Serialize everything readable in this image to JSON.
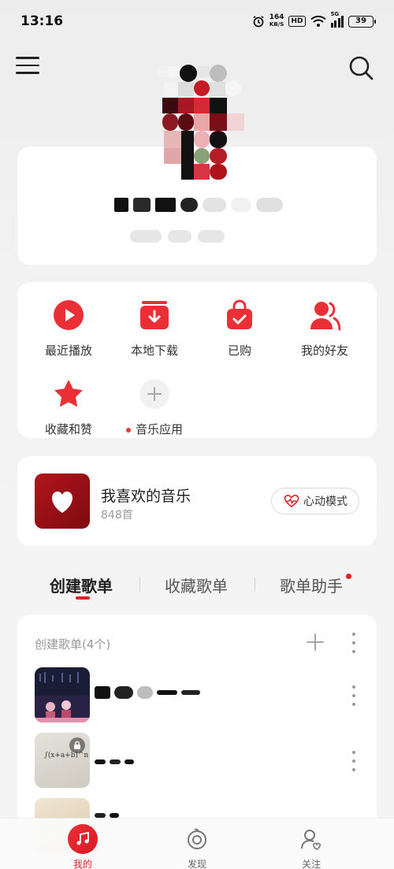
{
  "status_bar": {
    "time": "13:16",
    "network_speed_value": "164",
    "network_speed_unit": "KB/S",
    "hd_label": "HD",
    "signal_label": "5G",
    "battery": "39"
  },
  "colors": {
    "accent": "#e5202b",
    "background": "#f3f3f3",
    "card": "#ffffff",
    "liked_cover": "#9e0f16"
  },
  "quick_actions": [
    {
      "label": "最近播放",
      "icon": "play-circle-icon"
    },
    {
      "label": "本地下载",
      "icon": "download-icon"
    },
    {
      "label": "已购",
      "icon": "shopping-bag-icon"
    },
    {
      "label": "我的好友",
      "icon": "friends-icon"
    },
    {
      "label": "收藏和赞",
      "icon": "star-icon"
    },
    {
      "label": "音乐应用",
      "icon": "plus-icon"
    }
  ],
  "liked": {
    "title": "我喜欢的音乐",
    "count": "848首",
    "mode_button": "心动模式"
  },
  "tabs": [
    {
      "label": "创建歌单",
      "active": true
    },
    {
      "label": "收藏歌单",
      "active": false
    },
    {
      "label": "歌单助手",
      "active": false,
      "badge": true
    }
  ],
  "playlists": {
    "header": "创建歌单(4个)",
    "cover_2_text": "∫(x+a+b)^n dx"
  },
  "bottom_nav": [
    {
      "label": "我的",
      "icon": "music-note-icon",
      "active": true
    },
    {
      "label": "发现",
      "icon": "discover-icon",
      "active": false
    },
    {
      "label": "关注",
      "icon": "follow-icon",
      "active": false
    }
  ]
}
